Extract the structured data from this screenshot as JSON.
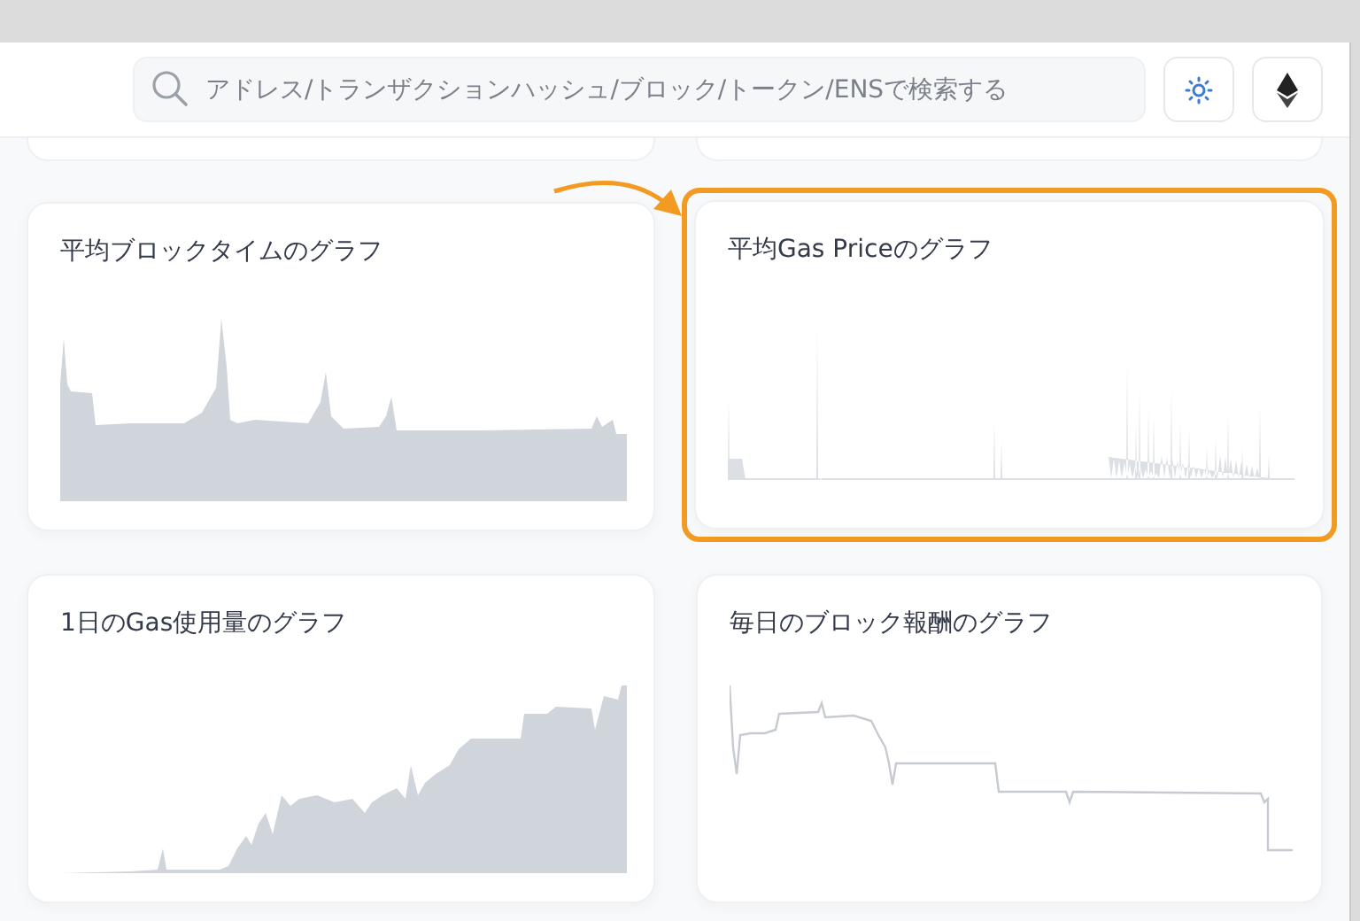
{
  "header": {
    "search": {
      "placeholder": "アドレス/トランザクションハッシュ/ブロック/トークン/ENSで検索する"
    }
  },
  "cards": [
    {
      "title": "平均ブロックタイムのグラフ",
      "kind": "blocktime",
      "highlighted": false
    },
    {
      "title": "平均Gas Priceのグラフ",
      "kind": "spikes",
      "highlighted": true
    },
    {
      "title": "1日のGas使用量のグラフ",
      "kind": "usage",
      "highlighted": false
    },
    {
      "title": "毎日のブロック報酬のグラフ",
      "kind": "reward",
      "highlighted": false
    }
  ]
}
